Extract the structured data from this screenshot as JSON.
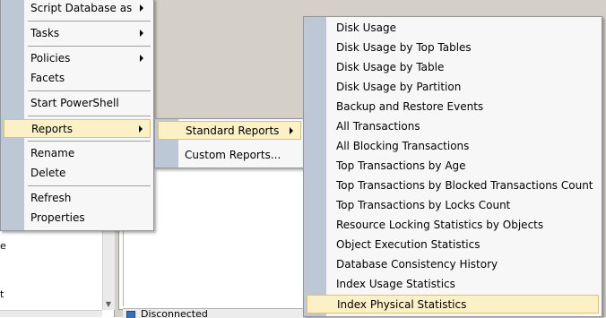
{
  "background": {
    "frag1": "e",
    "frag2": "t",
    "status_text": "Disconnected"
  },
  "context_menu": {
    "items": [
      {
        "label": "Script Database as",
        "submenu": true
      },
      {
        "label": "Tasks",
        "submenu": true
      },
      {
        "label": "Policies",
        "submenu": true
      },
      {
        "label": "Facets",
        "submenu": false
      },
      {
        "label": "Start PowerShell",
        "submenu": false
      },
      {
        "label": "Reports",
        "submenu": true,
        "highlighted": true
      },
      {
        "label": "Rename",
        "submenu": false
      },
      {
        "label": "Delete",
        "submenu": false
      },
      {
        "label": "Refresh",
        "submenu": false
      },
      {
        "label": "Properties",
        "submenu": false
      }
    ]
  },
  "reports_submenu": {
    "items": [
      {
        "label": "Standard Reports",
        "submenu": true,
        "highlighted": true
      },
      {
        "label": "Custom Reports...",
        "submenu": false
      }
    ]
  },
  "standard_reports_menu": {
    "items": [
      "Disk Usage",
      "Disk Usage by Top Tables",
      "Disk Usage by Table",
      "Disk Usage by Partition",
      "Backup and Restore Events",
      "All Transactions",
      "All Blocking Transactions",
      "Top Transactions by Age",
      "Top Transactions by Blocked Transactions Count",
      "Top Transactions by Locks Count",
      "Resource Locking Statistics by Objects",
      "Object Execution Statistics",
      "Database Consistency History",
      "Index Usage Statistics",
      "Index Physical Statistics"
    ],
    "highlighted_index": 14
  },
  "colors": {
    "highlight_fill": "#fbf0c6",
    "highlight_border": "#e5c365",
    "gutter": "#bdc8d6",
    "menu_bg": "#f7f7f7"
  }
}
